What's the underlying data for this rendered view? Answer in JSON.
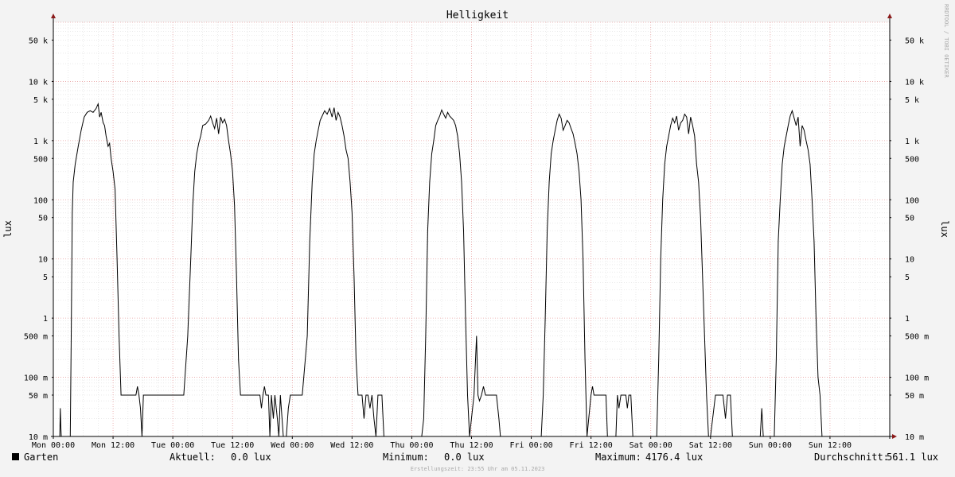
{
  "chart_data": {
    "type": "line",
    "title": "Helligkeit",
    "ylabel": "lux",
    "y_scale": "log",
    "ylim": [
      0.01,
      100000
    ],
    "y_ticks": [
      {
        "value": 50000,
        "label": "50 k"
      },
      {
        "value": 10000,
        "label": "10 k"
      },
      {
        "value": 5000,
        "label": "5 k"
      },
      {
        "value": 1000,
        "label": "1 k"
      },
      {
        "value": 500,
        "label": "500"
      },
      {
        "value": 100,
        "label": "100"
      },
      {
        "value": 50,
        "label": "50"
      },
      {
        "value": 10,
        "label": "10"
      },
      {
        "value": 5,
        "label": "5"
      },
      {
        "value": 1,
        "label": "1"
      },
      {
        "value": 0.5,
        "label": "500 m"
      },
      {
        "value": 0.1,
        "label": "100 m"
      },
      {
        "value": 0.05,
        "label": "50 m"
      },
      {
        "value": 0.01,
        "label": "10 m"
      }
    ],
    "x_unit": "hours",
    "xlim": [
      0,
      168
    ],
    "x_ticks": [
      {
        "value": 0,
        "label": "Mon 00:00"
      },
      {
        "value": 12,
        "label": "Mon 12:00"
      },
      {
        "value": 24,
        "label": "Tue 00:00"
      },
      {
        "value": 36,
        "label": "Tue 12:00"
      },
      {
        "value": 48,
        "label": "Wed 00:00"
      },
      {
        "value": 60,
        "label": "Wed 12:00"
      },
      {
        "value": 72,
        "label": "Thu 00:00"
      },
      {
        "value": 84,
        "label": "Thu 12:00"
      },
      {
        "value": 96,
        "label": "Fri 00:00"
      },
      {
        "value": 108,
        "label": "Fri 12:00"
      },
      {
        "value": 120,
        "label": "Sat 00:00"
      },
      {
        "value": 132,
        "label": "Sat 12:00"
      },
      {
        "value": 144,
        "label": "Sun 00:00"
      },
      {
        "value": 156,
        "label": "Sun 12:00"
      }
    ],
    "grid": true,
    "series": [
      {
        "name": "Garten",
        "color": "#000000",
        "points": [
          [
            0,
            0.01
          ],
          [
            1.3,
            0.01
          ],
          [
            1.4,
            0.03
          ],
          [
            1.5,
            0.015
          ],
          [
            1.6,
            0.01
          ],
          [
            3.2,
            0.01
          ],
          [
            3.4,
            0.01
          ],
          [
            3.6,
            0.5
          ],
          [
            3.8,
            60
          ],
          [
            4.0,
            200
          ],
          [
            4.4,
            400
          ],
          [
            5.0,
            800
          ],
          [
            5.6,
            1500
          ],
          [
            6.2,
            2500
          ],
          [
            6.8,
            3000
          ],
          [
            7.4,
            3200
          ],
          [
            8.0,
            3000
          ],
          [
            8.6,
            3500
          ],
          [
            9.0,
            4176
          ],
          [
            9.3,
            2500
          ],
          [
            9.6,
            3000
          ],
          [
            10.0,
            2000
          ],
          [
            10.3,
            1800
          ],
          [
            10.6,
            1200
          ],
          [
            11.0,
            800
          ],
          [
            11.3,
            900
          ],
          [
            11.6,
            500
          ],
          [
            12.0,
            300
          ],
          [
            12.4,
            150
          ],
          [
            12.8,
            10
          ],
          [
            13.2,
            0.5
          ],
          [
            13.6,
            0.05
          ],
          [
            16.0,
            0.05
          ],
          [
            16.6,
            0.05
          ],
          [
            16.9,
            0.07
          ],
          [
            17.2,
            0.05
          ],
          [
            17.5,
            0.03
          ],
          [
            17.8,
            0.01
          ],
          [
            18.1,
            0.05
          ],
          [
            21.0,
            0.05
          ],
          [
            23.0,
            0.05
          ],
          [
            24.0,
            0.05
          ],
          [
            25.5,
            0.05
          ],
          [
            26.2,
            0.05
          ],
          [
            27.0,
            0.5
          ],
          [
            27.6,
            10
          ],
          [
            28.0,
            80
          ],
          [
            28.4,
            300
          ],
          [
            28.8,
            600
          ],
          [
            29.2,
            900
          ],
          [
            29.6,
            1200
          ],
          [
            30.0,
            1800
          ],
          [
            30.6,
            1900
          ],
          [
            31.2,
            2200
          ],
          [
            31.6,
            2600
          ],
          [
            32.0,
            2000
          ],
          [
            32.4,
            1600
          ],
          [
            32.8,
            2400
          ],
          [
            33.2,
            1300
          ],
          [
            33.6,
            2500
          ],
          [
            34.0,
            2000
          ],
          [
            34.4,
            2300
          ],
          [
            34.8,
            1800
          ],
          [
            35.2,
            1000
          ],
          [
            35.6,
            600
          ],
          [
            36.0,
            300
          ],
          [
            36.4,
            80
          ],
          [
            36.8,
            5
          ],
          [
            37.2,
            0.2
          ],
          [
            37.6,
            0.05
          ],
          [
            40.0,
            0.05
          ],
          [
            41.5,
            0.05
          ],
          [
            41.8,
            0.03
          ],
          [
            42.1,
            0.05
          ],
          [
            42.4,
            0.07
          ],
          [
            42.7,
            0.05
          ],
          [
            43.2,
            0.05
          ],
          [
            43.5,
            0.01
          ],
          [
            43.8,
            0.05
          ],
          [
            44.2,
            0.02
          ],
          [
            44.5,
            0.05
          ],
          [
            45.0,
            0.02
          ],
          [
            45.3,
            0.01
          ],
          [
            45.6,
            0.05
          ],
          [
            46.2,
            0.01
          ],
          [
            46.8,
            0.01
          ],
          [
            47.2,
            0.03
          ],
          [
            47.6,
            0.05
          ],
          [
            49.0,
            0.05
          ],
          [
            50.0,
            0.05
          ],
          [
            51.0,
            0.5
          ],
          [
            51.5,
            20
          ],
          [
            52.0,
            200
          ],
          [
            52.4,
            600
          ],
          [
            52.8,
            1000
          ],
          [
            53.2,
            1500
          ],
          [
            53.6,
            2200
          ],
          [
            54.0,
            2600
          ],
          [
            54.5,
            3200
          ],
          [
            55.0,
            2800
          ],
          [
            55.5,
            3500
          ],
          [
            56.0,
            2500
          ],
          [
            56.4,
            3600
          ],
          [
            56.8,
            2200
          ],
          [
            57.2,
            3000
          ],
          [
            57.6,
            2500
          ],
          [
            58.0,
            1800
          ],
          [
            58.4,
            1200
          ],
          [
            58.8,
            700
          ],
          [
            59.2,
            500
          ],
          [
            59.6,
            200
          ],
          [
            60.0,
            60
          ],
          [
            60.4,
            5
          ],
          [
            60.8,
            0.2
          ],
          [
            61.2,
            0.05
          ],
          [
            62.0,
            0.05
          ],
          [
            62.4,
            0.02
          ],
          [
            62.8,
            0.05
          ],
          [
            63.2,
            0.05
          ],
          [
            63.6,
            0.03
          ],
          [
            64.0,
            0.05
          ],
          [
            64.4,
            0.02
          ],
          [
            64.8,
            0.01
          ],
          [
            65.2,
            0.05
          ],
          [
            66.0,
            0.05
          ],
          [
            66.4,
            0.01
          ],
          [
            68.0,
            0.01
          ],
          [
            70.0,
            0.01
          ],
          [
            72.0,
            0.01
          ],
          [
            74.0,
            0.01
          ],
          [
            74.4,
            0.02
          ],
          [
            74.8,
            0.5
          ],
          [
            75.2,
            30
          ],
          [
            75.6,
            200
          ],
          [
            76.0,
            600
          ],
          [
            76.4,
            1000
          ],
          [
            76.8,
            1800
          ],
          [
            77.2,
            2200
          ],
          [
            77.6,
            2600
          ],
          [
            78.0,
            3300
          ],
          [
            78.4,
            2800
          ],
          [
            78.8,
            2400
          ],
          [
            79.2,
            3000
          ],
          [
            79.6,
            2600
          ],
          [
            80.0,
            2400
          ],
          [
            80.4,
            2200
          ],
          [
            80.8,
            1800
          ],
          [
            81.2,
            1200
          ],
          [
            81.6,
            600
          ],
          [
            82.0,
            200
          ],
          [
            82.4,
            30
          ],
          [
            82.8,
            1
          ],
          [
            83.2,
            0.05
          ],
          [
            83.6,
            0.01
          ],
          [
            84.5,
            0.05
          ],
          [
            85.0,
            0.5
          ],
          [
            85.3,
            0.05
          ],
          [
            85.6,
            0.04
          ],
          [
            86.0,
            0.05
          ],
          [
            86.4,
            0.07
          ],
          [
            86.8,
            0.05
          ],
          [
            87.4,
            0.05
          ],
          [
            88.0,
            0.05
          ],
          [
            89.0,
            0.05
          ],
          [
            89.5,
            0.02
          ],
          [
            89.8,
            0.01
          ],
          [
            90.0,
            0.01
          ],
          [
            92.0,
            0.01
          ],
          [
            94.0,
            0.01
          ],
          [
            96.0,
            0.01
          ],
          [
            98.0,
            0.01
          ],
          [
            98.4,
            0.05
          ],
          [
            98.8,
            1
          ],
          [
            99.2,
            30
          ],
          [
            99.6,
            200
          ],
          [
            100.0,
            600
          ],
          [
            100.4,
            1000
          ],
          [
            100.8,
            1500
          ],
          [
            101.2,
            2200
          ],
          [
            101.6,
            2800
          ],
          [
            102.0,
            2400
          ],
          [
            102.4,
            1500
          ],
          [
            102.8,
            1800
          ],
          [
            103.2,
            2200
          ],
          [
            103.6,
            2000
          ],
          [
            104.0,
            1600
          ],
          [
            104.4,
            1300
          ],
          [
            104.8,
            900
          ],
          [
            105.2,
            600
          ],
          [
            105.6,
            300
          ],
          [
            106.0,
            100
          ],
          [
            106.4,
            10
          ],
          [
            106.8,
            0.2
          ],
          [
            107.2,
            0.01
          ],
          [
            108.0,
            0.05
          ],
          [
            108.3,
            0.07
          ],
          [
            108.6,
            0.05
          ],
          [
            110.0,
            0.05
          ],
          [
            111.0,
            0.05
          ],
          [
            111.3,
            0.01
          ],
          [
            112.0,
            0.01
          ],
          [
            113.0,
            0.01
          ],
          [
            113.3,
            0.05
          ],
          [
            113.6,
            0.03
          ],
          [
            114.0,
            0.05
          ],
          [
            115.0,
            0.05
          ],
          [
            115.3,
            0.03
          ],
          [
            115.6,
            0.05
          ],
          [
            116.0,
            0.05
          ],
          [
            116.4,
            0.01
          ],
          [
            118.0,
            0.01
          ],
          [
            120.0,
            0.01
          ],
          [
            121.2,
            0.01
          ],
          [
            121.6,
            0.2
          ],
          [
            122.0,
            10
          ],
          [
            122.4,
            100
          ],
          [
            122.8,
            400
          ],
          [
            123.2,
            800
          ],
          [
            123.6,
            1200
          ],
          [
            124.0,
            1800
          ],
          [
            124.4,
            2400
          ],
          [
            124.8,
            2000
          ],
          [
            125.2,
            2600
          ],
          [
            125.6,
            1500
          ],
          [
            126.0,
            2000
          ],
          [
            126.4,
            2200
          ],
          [
            126.8,
            2800
          ],
          [
            127.2,
            2500
          ],
          [
            127.6,
            1300
          ],
          [
            128.0,
            2500
          ],
          [
            128.4,
            1800
          ],
          [
            128.8,
            1200
          ],
          [
            129.2,
            400
          ],
          [
            129.6,
            200
          ],
          [
            130.0,
            50
          ],
          [
            130.4,
            5
          ],
          [
            130.8,
            0.5
          ],
          [
            131.2,
            0.05
          ],
          [
            131.6,
            0.01
          ],
          [
            132.0,
            0.01
          ],
          [
            133.0,
            0.05
          ],
          [
            134.5,
            0.05
          ],
          [
            135.0,
            0.02
          ],
          [
            135.4,
            0.05
          ],
          [
            136.0,
            0.05
          ],
          [
            136.4,
            0.01
          ],
          [
            137.0,
            0.01
          ],
          [
            140.0,
            0.01
          ],
          [
            142.0,
            0.01
          ],
          [
            142.3,
            0.03
          ],
          [
            142.6,
            0.01
          ],
          [
            143.5,
            0.01
          ],
          [
            144.0,
            0.01
          ],
          [
            144.8,
            0.01
          ],
          [
            145.2,
            0.2
          ],
          [
            145.6,
            20
          ],
          [
            146.0,
            100
          ],
          [
            146.4,
            400
          ],
          [
            146.8,
            800
          ],
          [
            147.2,
            1200
          ],
          [
            147.6,
            1800
          ],
          [
            148.0,
            2600
          ],
          [
            148.4,
            3200
          ],
          [
            148.8,
            2400
          ],
          [
            149.2,
            1800
          ],
          [
            149.6,
            2500
          ],
          [
            150.0,
            800
          ],
          [
            150.4,
            1800
          ],
          [
            150.8,
            1500
          ],
          [
            151.2,
            1000
          ],
          [
            151.6,
            700
          ],
          [
            152.0,
            400
          ],
          [
            152.4,
            100
          ],
          [
            152.8,
            20
          ],
          [
            153.2,
            1
          ],
          [
            153.6,
            0.1
          ],
          [
            154.0,
            0.05
          ],
          [
            154.4,
            0.01
          ],
          [
            158.0,
            0.01
          ],
          [
            168.0,
            0.01
          ]
        ]
      }
    ]
  },
  "legend": {
    "series_label": "Garten",
    "swatch_color": "#000000",
    "current_label": "Aktuell:",
    "current_value": "0.0 lux",
    "minimum_label": "Minimum:",
    "minimum_value": "0.0 lux",
    "maximum_label": "Maximum:",
    "maximum_value": "4176.4 lux",
    "average_label": "Durchschnitt:",
    "average_value": "561.1 lux"
  },
  "footer": {
    "creation_time": "Erstellungszeit: 23:55 Uhr am 05.11.2023"
  },
  "watermark": "RRDTOOL / TOBI OETIKER",
  "colors": {
    "background": "#f3f3f3",
    "plot_background": "#ffffff",
    "major_grid": "#e8a0a0",
    "minor_grid": "#dddddd",
    "line": "#000000",
    "arrow": "#8b1a1a"
  }
}
